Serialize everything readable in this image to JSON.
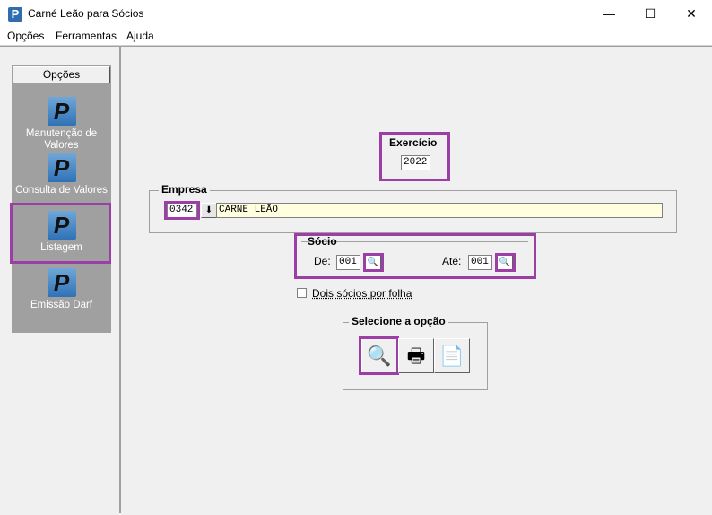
{
  "window": {
    "title": "Carné Leão para Sócios",
    "app_icon_letter": "P",
    "minimize_glyph": "—",
    "maximize_glyph": "☐",
    "close_glyph": "✕"
  },
  "menu": {
    "items": [
      {
        "label": "Opções"
      },
      {
        "label": "Ferramentas"
      },
      {
        "label": "Ajuda"
      }
    ]
  },
  "sidebar": {
    "header": "Opções",
    "icon_letter": "P",
    "items": [
      {
        "label": "Manutenção de Valores",
        "icon": "p-icon"
      },
      {
        "label": "Consulta de Valores",
        "icon": "p-icon"
      },
      {
        "label": "Listagem",
        "icon": "p-icon",
        "selected": true
      },
      {
        "label": "Emissão Darf",
        "icon": "p-icon"
      }
    ]
  },
  "exercicio": {
    "title": "Exercício",
    "value": "2022"
  },
  "empresa": {
    "title": "Empresa",
    "code": "0342",
    "name": "CARNE LEÃO",
    "lookup_glyph": "⬇"
  },
  "socio": {
    "title": "Sócio",
    "from_label": "De:",
    "from_value": "001",
    "to_label": "Até:",
    "to_value": "001"
  },
  "options": {
    "dois_socios_label": "Dois sócios por folha",
    "dois_socios_checked": false
  },
  "selecione": {
    "title": "Selecione a opção",
    "preview_glyph": "🔍",
    "print_glyph": "🖶",
    "export_glyph": "📄"
  },
  "colors": {
    "highlight": "#9b3fa7",
    "sidebar_bg": "#a0a0a0",
    "empresa_name_bg": "#ffffe0"
  }
}
